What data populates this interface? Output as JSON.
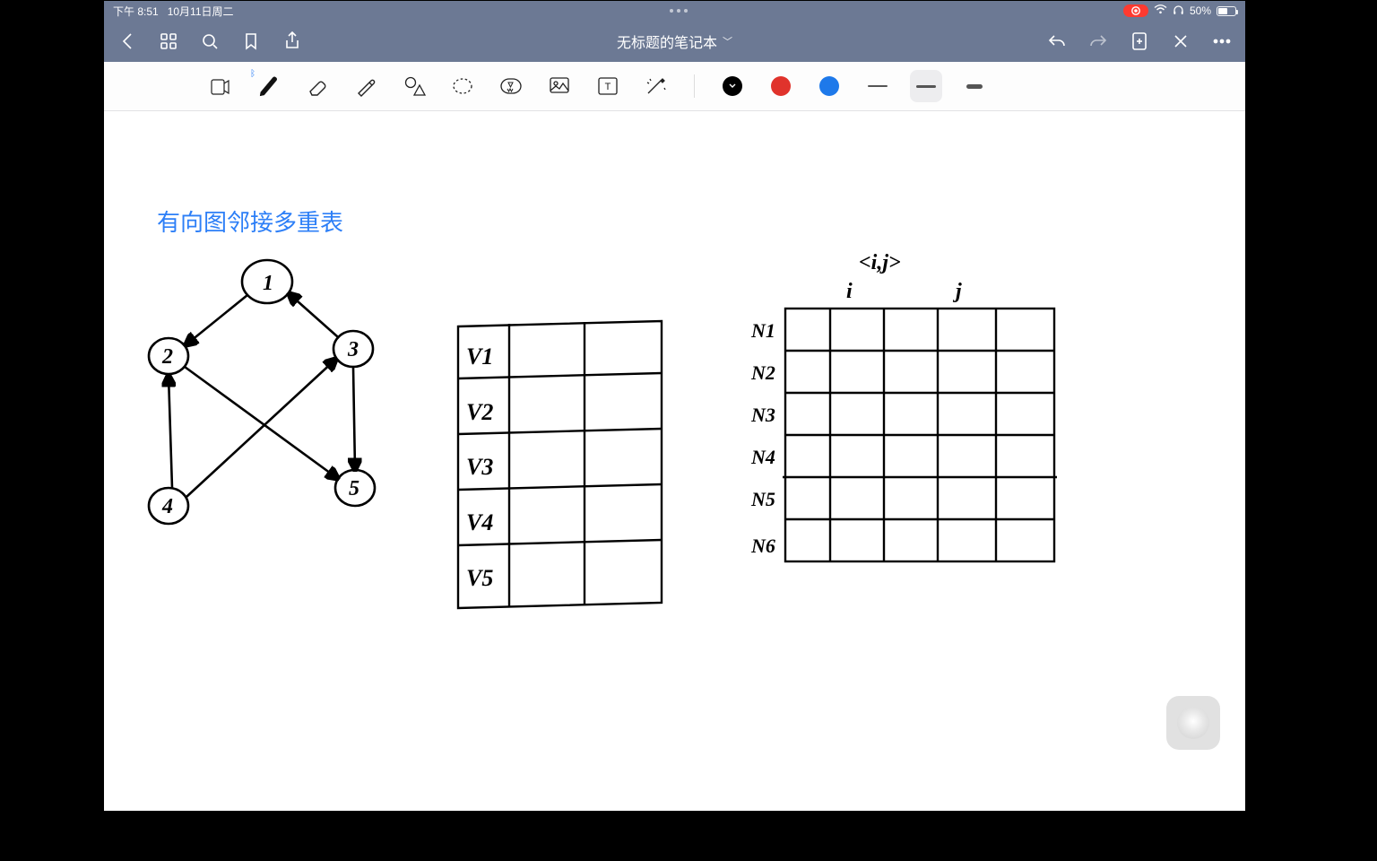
{
  "status": {
    "time": "下午 8:51",
    "date": "10月11日周二",
    "battery_text": "50%",
    "battery_fill_pct": 50
  },
  "nav": {
    "title": "无标题的笔记本"
  },
  "colors": {
    "black": "#000000",
    "red": "#e0332c",
    "blue": "#1e79ea"
  },
  "canvas": {
    "heading": "有向图邻接多重表",
    "graph": {
      "nodes": [
        "1",
        "2",
        "3",
        "4",
        "5"
      ],
      "edges": [
        {
          "from": "1",
          "to": "2"
        },
        {
          "from": "3",
          "to": "1"
        },
        {
          "from": "3",
          "to": "5"
        },
        {
          "from": "2",
          "to": "5"
        },
        {
          "from": "4",
          "to": "2"
        },
        {
          "from": "4",
          "to": "3"
        }
      ]
    },
    "table1_rows": [
      "V1",
      "V2",
      "V3",
      "V4",
      "V5"
    ],
    "table2_header": "<i,j>",
    "table2_col_labels": [
      "i",
      "j"
    ],
    "table2_rows": [
      "N1",
      "N2",
      "N3",
      "N4",
      "N5",
      "N6"
    ]
  }
}
